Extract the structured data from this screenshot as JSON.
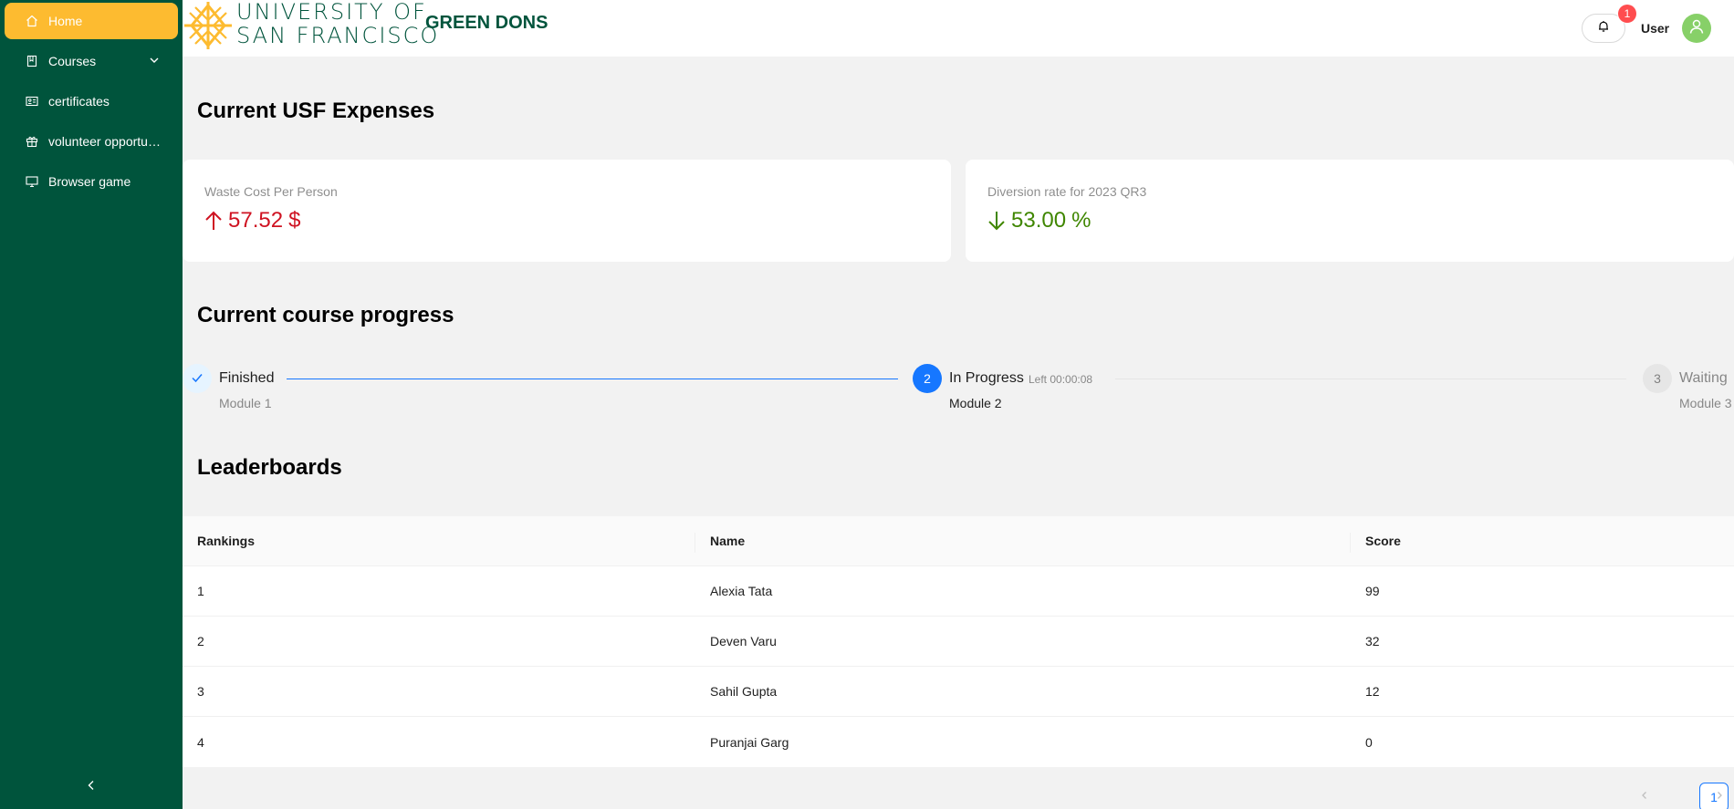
{
  "colors": {
    "sidebar_bg": "#00543c",
    "active_item": "#fdbb30",
    "brand_green": "#00543c",
    "logo_gold": "#fdbb30",
    "increase_red": "#cf1322",
    "decrease_green": "#3f8600",
    "primary_blue": "#1677ff"
  },
  "sidebar": {
    "items": [
      {
        "label": "Home",
        "icon": "home-icon"
      },
      {
        "label": "Courses",
        "icon": "book-icon"
      },
      {
        "label": "certificates",
        "icon": "id-card-icon"
      },
      {
        "label": "volunteer opportunities",
        "icon": "gift-icon"
      },
      {
        "label": "Browser game",
        "icon": "desktop-icon"
      }
    ],
    "collapse_icon": "chevron-left-icon"
  },
  "header": {
    "logo_line1": "UNIVERSITY OF",
    "logo_line2": "SAN FRANCISCO",
    "brand": "GREEN DONS",
    "notification_count": "1",
    "user_name": "User"
  },
  "expenses": {
    "title": "Current USF Expenses",
    "cards": [
      {
        "title": "Waste Cost Per Person",
        "value": "57.52",
        "suffix": "$",
        "trend": "up"
      },
      {
        "title": "Diversion rate for 2023 QR3",
        "value": "53.00",
        "suffix": "%",
        "trend": "down"
      }
    ]
  },
  "progress": {
    "title": "Current course progress",
    "steps": [
      {
        "status": "finish",
        "title": "Finished",
        "description": "Module 1"
      },
      {
        "status": "process",
        "number": "2",
        "title": "In Progress",
        "subtitle": "Left 00:00:08",
        "description": "Module 2"
      },
      {
        "status": "wait",
        "number": "3",
        "title": "Waiting",
        "description": "Module 3"
      }
    ]
  },
  "leaderboard": {
    "title": "Leaderboards",
    "columns": [
      "Rankings",
      "Name",
      "Score"
    ],
    "rows": [
      [
        "1",
        "Alexia Tata",
        "99"
      ],
      [
        "2",
        "Deven Varu",
        "32"
      ],
      [
        "3",
        "Sahil Gupta",
        "12"
      ],
      [
        "4",
        "Puranjai Garg",
        "0"
      ]
    ],
    "pagination": {
      "current": "1"
    }
  }
}
